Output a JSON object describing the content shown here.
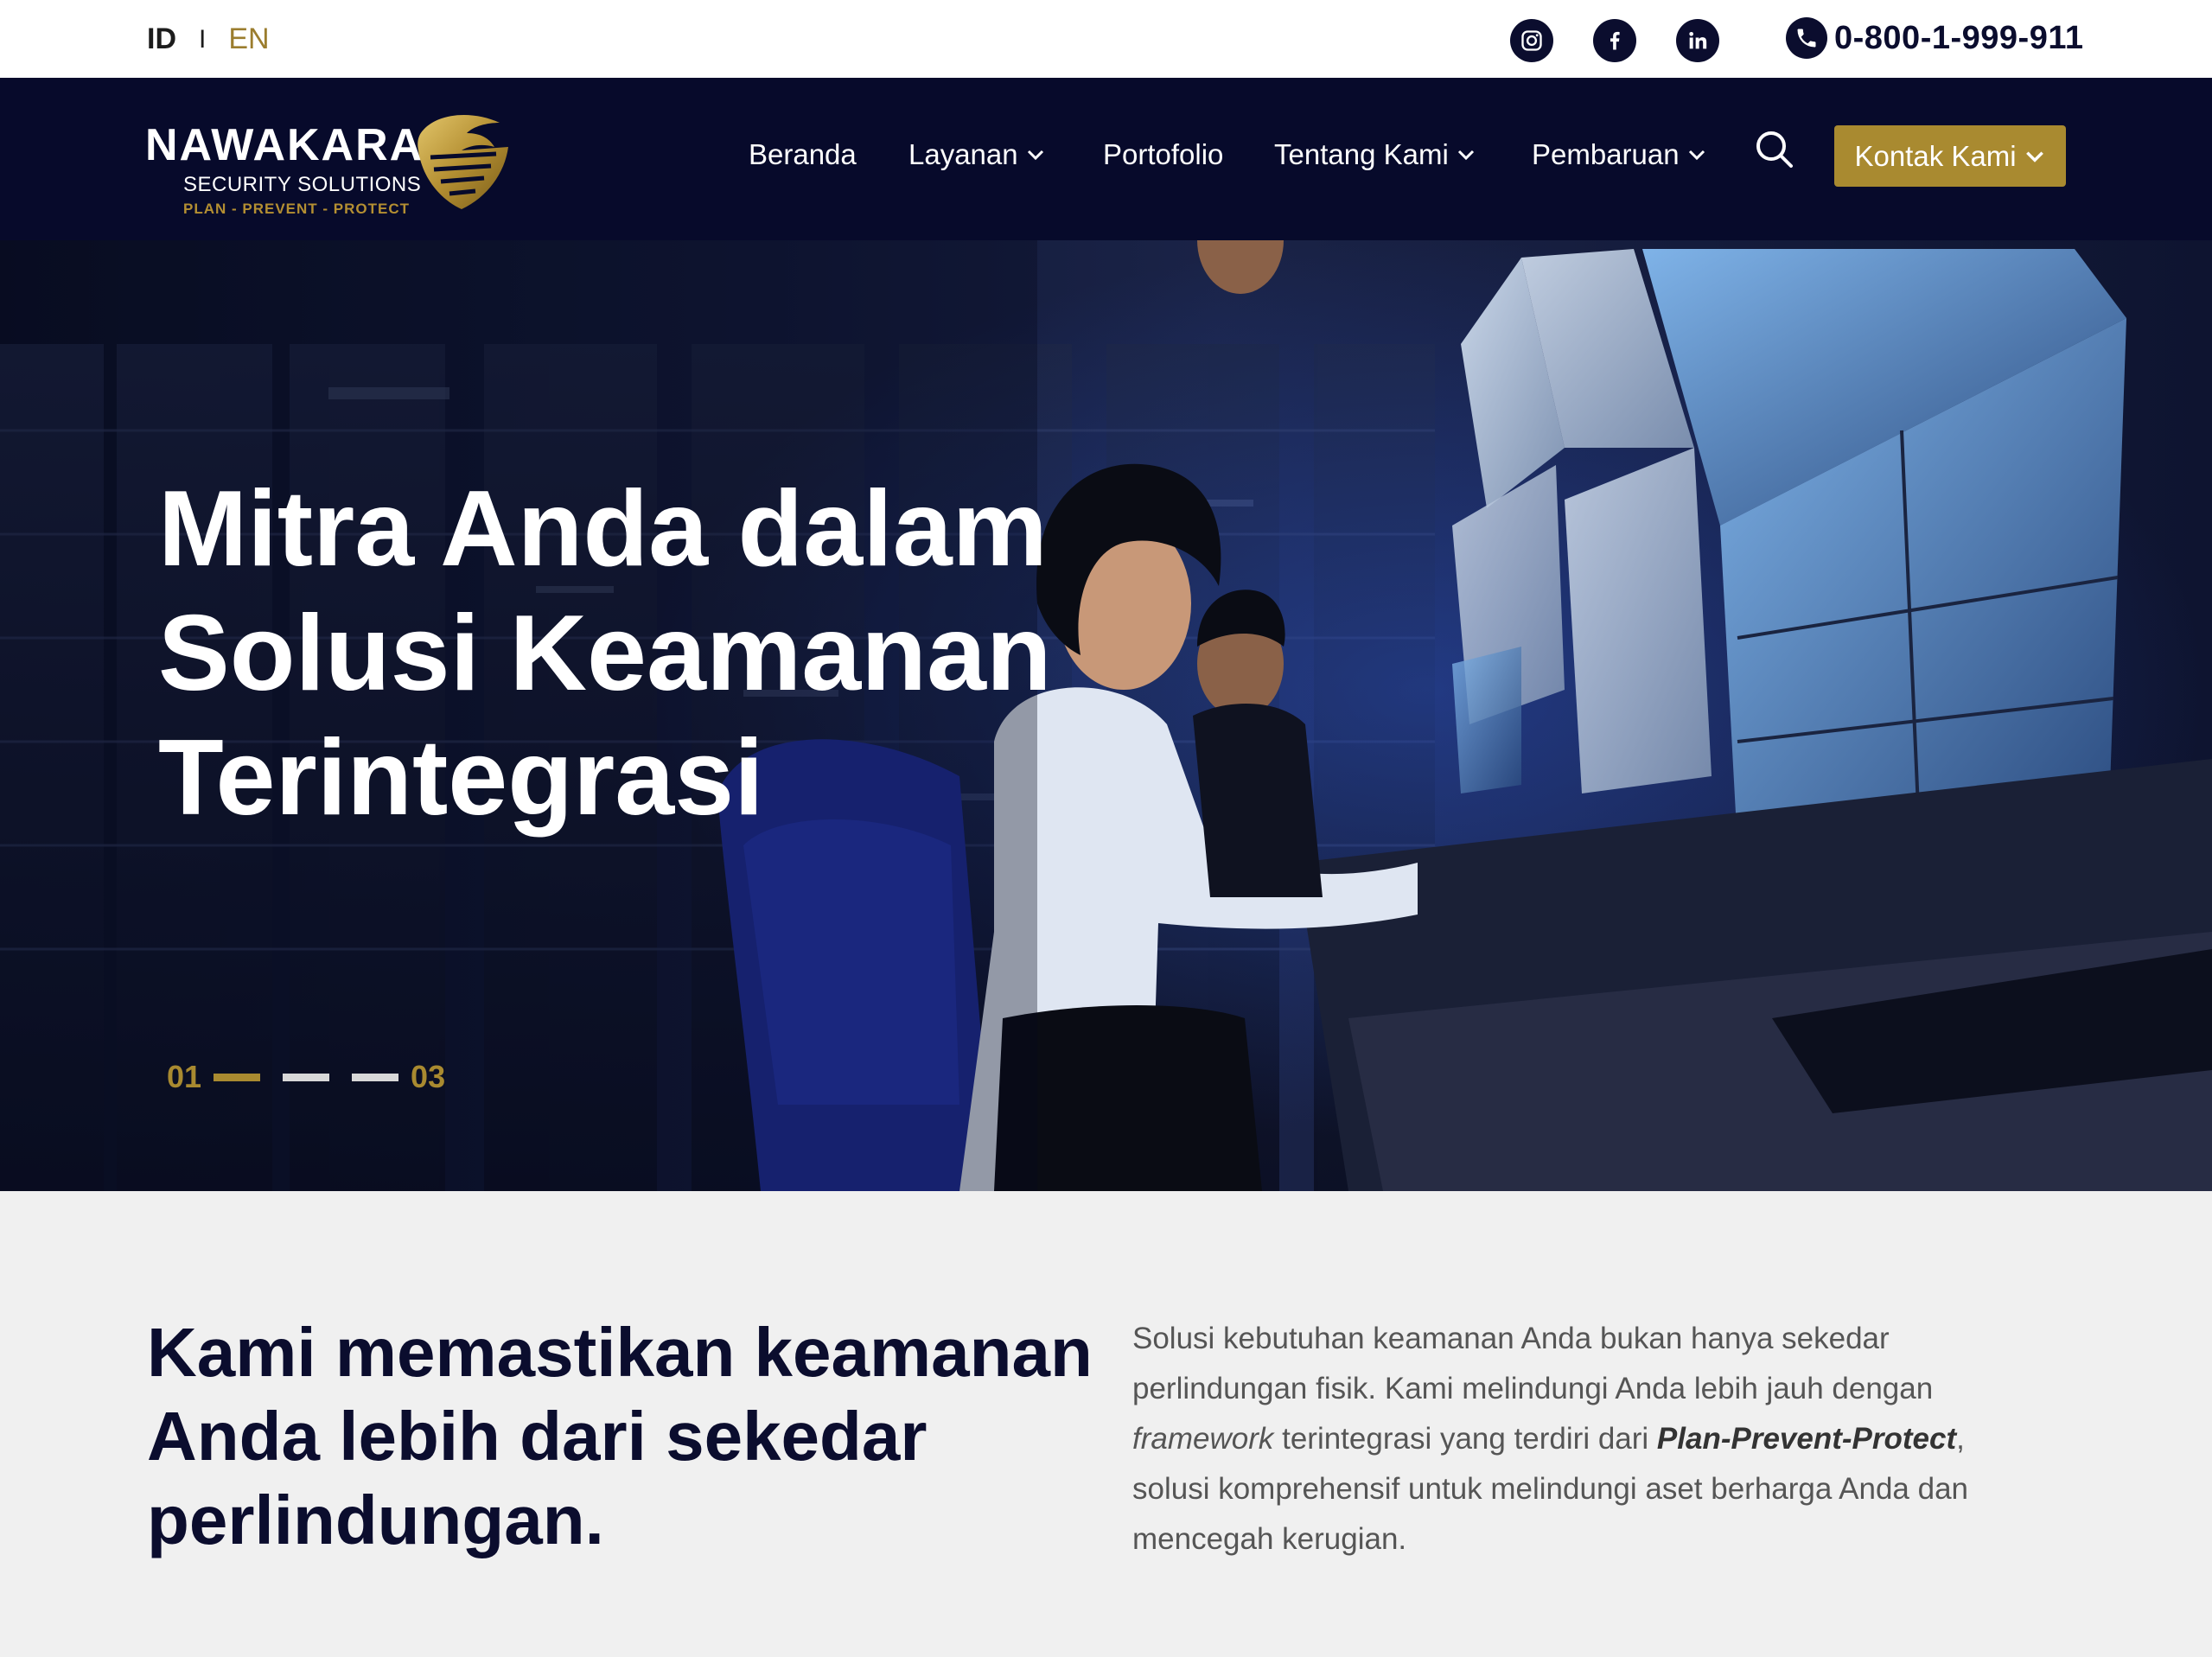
{
  "topbar": {
    "lang_id": "ID",
    "lang_sep": "I",
    "lang_en": "EN",
    "phone": "0-800-1-999-911"
  },
  "logo": {
    "brand": "NAWAKARA",
    "sub": "SECURITY SOLUTIONS",
    "tag": "PLAN - PREVENT - PROTECT"
  },
  "nav": {
    "items": [
      {
        "label": "Beranda"
      },
      {
        "label": "Layanan"
      },
      {
        "label": "Portofolio"
      },
      {
        "label": "Tentang Kami"
      },
      {
        "label": "Pembaruan"
      }
    ],
    "cta": "Kontak Kami"
  },
  "hero": {
    "title": "Mitra Anda dalam Solusi Keamanan Terintegrasi",
    "slide_current": "01",
    "slide_total": "03"
  },
  "intro": {
    "heading": "Kami memastikan keamanan Anda lebih dari sekedar perlindungan.",
    "p1": "Solusi kebutuhan keamanan Anda bukan hanya sekedar perlindungan fisik. Kami melindungi Anda lebih jauh dengan ",
    "em": "framework",
    "p2": " terintegrasi yang terdiri dari ",
    "strong": "Plan-Prevent-Protect",
    "p3": ", solusi komprehensif untuk melindungi aset berharga Anda dan mencegah kerugian."
  },
  "colors": {
    "navy": "#070a2b",
    "gold": "#a98a30",
    "light_bg": "#f0f0f0"
  }
}
